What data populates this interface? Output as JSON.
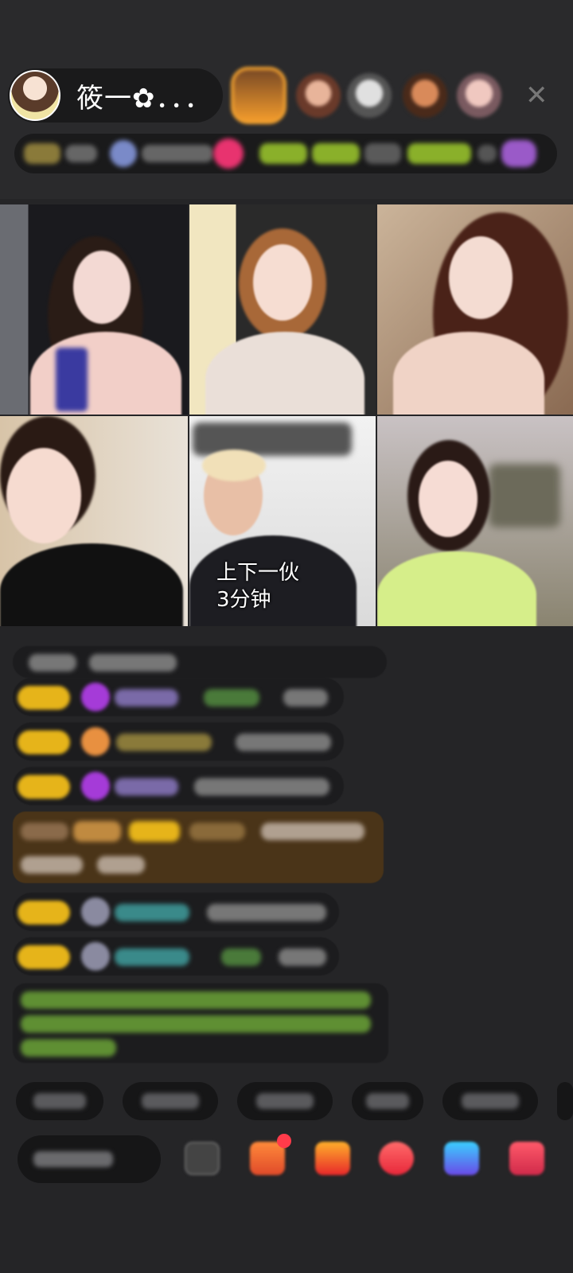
{
  "host": {
    "name": "筱一✿．．．"
  },
  "overlay_captions": {
    "tile5_line1": "上下一伙",
    "tile5_line2": "3分钟"
  },
  "icons": {
    "close": "close-icon",
    "gift_box": "gift-box-icon",
    "notification_color": "#ff3b4a"
  },
  "colors": {
    "background": "#252527",
    "chat_bubble": "#1c1c1e",
    "level_badge": "#e6b41a",
    "highlight_bubble": "#4a3418",
    "system_text_green": "#6fa33a"
  }
}
